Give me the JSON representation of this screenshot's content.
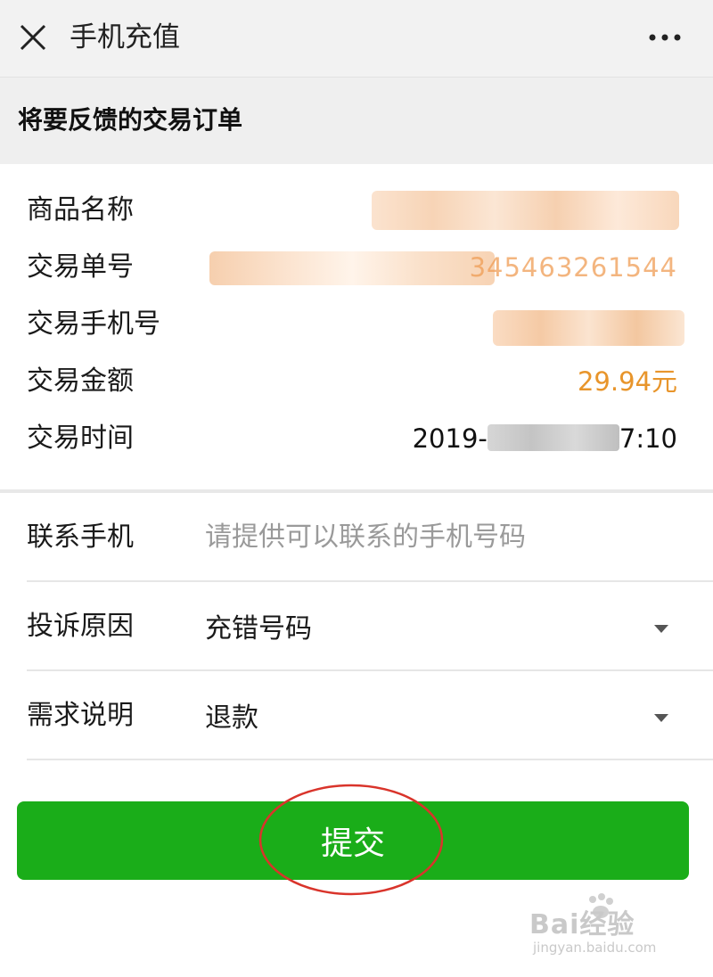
{
  "topbar": {
    "close_icon": "close-icon",
    "title": "手机充值",
    "more_icon": "more-icon"
  },
  "section_header": "将要反馈的交易订单",
  "details": {
    "product_name_label": "商品名称",
    "order_no_label": "交易单号",
    "order_no_visible_tail": "345463261544",
    "phone_label": "交易手机号",
    "amount_label": "交易金额",
    "amount_value": "29.94元",
    "time_label": "交易时间",
    "time_prefix": "2019-",
    "time_suffix": "7:10"
  },
  "form": {
    "contact_label": "联系手机",
    "contact_placeholder": "请提供可以联系的手机号码",
    "reason_label": "投诉原因",
    "reason_value": "充错号码",
    "need_label": "需求说明",
    "need_value": "退款"
  },
  "submit_label": "提交",
  "watermark": {
    "main": "Bai经验",
    "sub": "jingyan.baidu.com"
  },
  "colors": {
    "primary_green": "#1aad19",
    "amount_orange": "#e8952b",
    "annotation_red": "#d9342b"
  }
}
